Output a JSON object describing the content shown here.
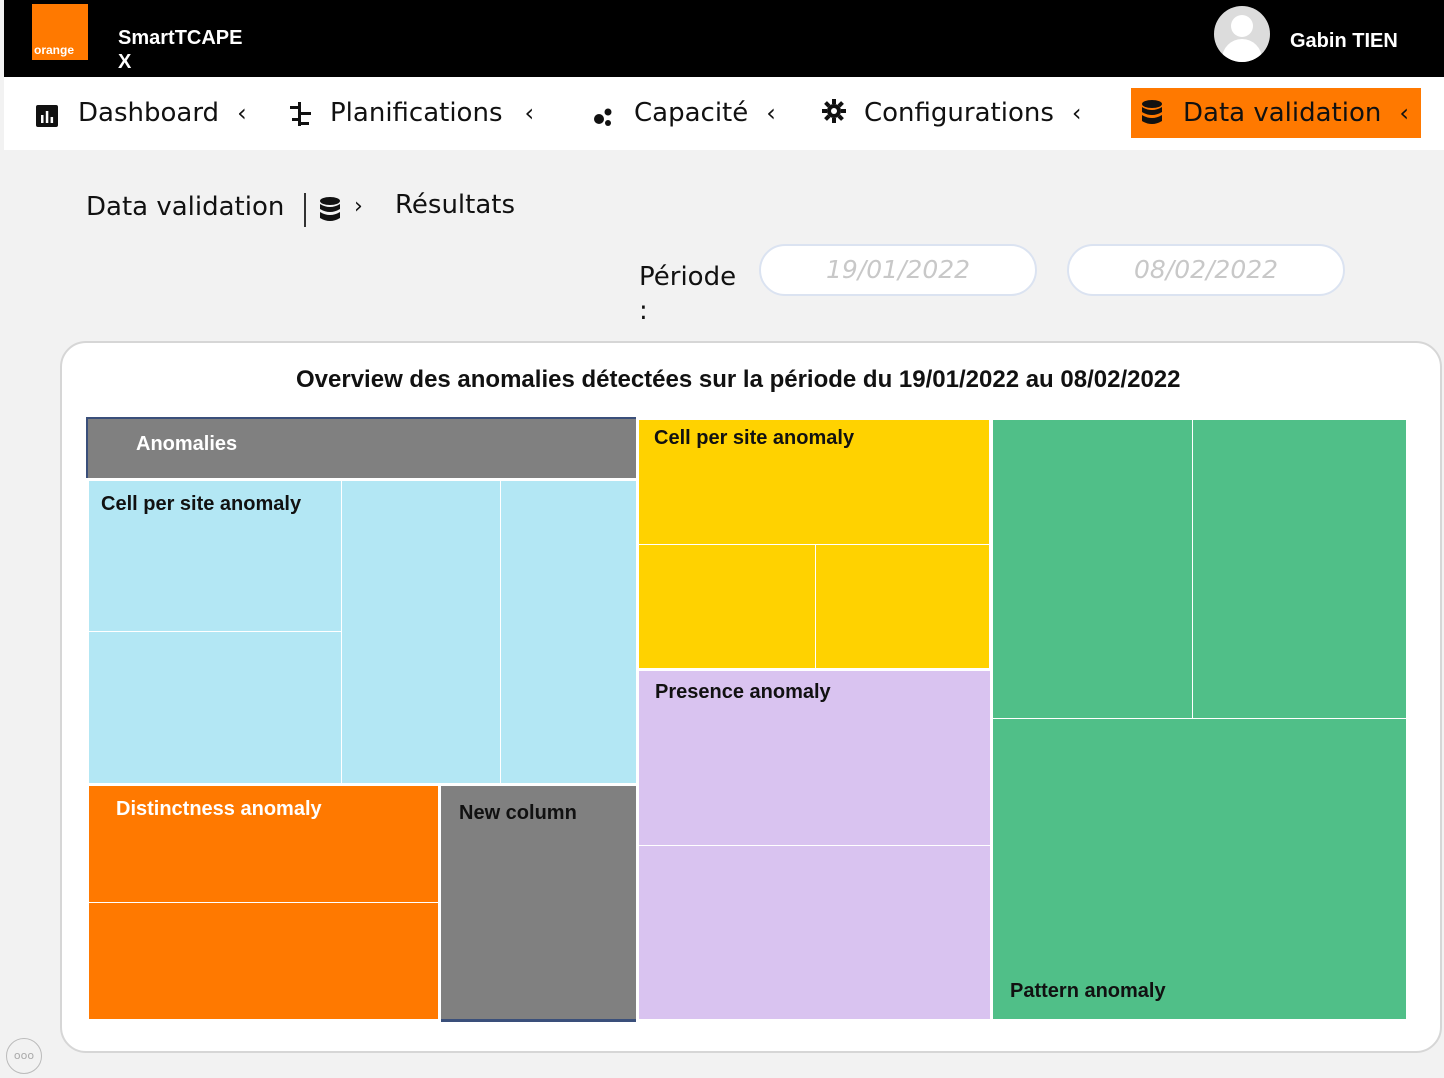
{
  "header": {
    "logo_text": "orange",
    "app_title_line1": "SmartTCAPE",
    "app_title_line2": "X",
    "username": "Gabin TIEN"
  },
  "nav": {
    "items": [
      {
        "label": "Dashboard",
        "icon": "bar-chart-icon"
      },
      {
        "label": "Planifications",
        "icon": "planning-icon"
      },
      {
        "label": "Capacité",
        "icon": "capacity-icon"
      },
      {
        "label": "Configurations",
        "icon": "gear-icon"
      },
      {
        "label": "Data validation",
        "icon": "database-icon",
        "active": true
      }
    ],
    "active_color": "#ff7900"
  },
  "breadcrumb": {
    "section": "Data validation",
    "page": "Résultats"
  },
  "period": {
    "label": "Période",
    "colon": ":",
    "start": "19/01/2022",
    "end": "08/02/2022"
  },
  "chart_data": {
    "type": "treemap",
    "title": "Overview des anomalies détectées sur la période du 19/01/2022 au 08/02/2022",
    "header_label": "Anomalies",
    "groups": [
      {
        "name": "Cell per site anomaly",
        "color": "#b3e7f4"
      },
      {
        "name": "Distinctness anomaly",
        "color": "#ff7900"
      },
      {
        "name": "New column",
        "color": "#808080"
      },
      {
        "name": "Cell per site anomaly",
        "color": "#ffd200"
      },
      {
        "name": "Presence anomaly",
        "color": "#d9c3f0"
      },
      {
        "name": "Pattern anomaly",
        "color": "#50bf88"
      }
    ]
  },
  "misc": {
    "more_label": "ooo"
  }
}
